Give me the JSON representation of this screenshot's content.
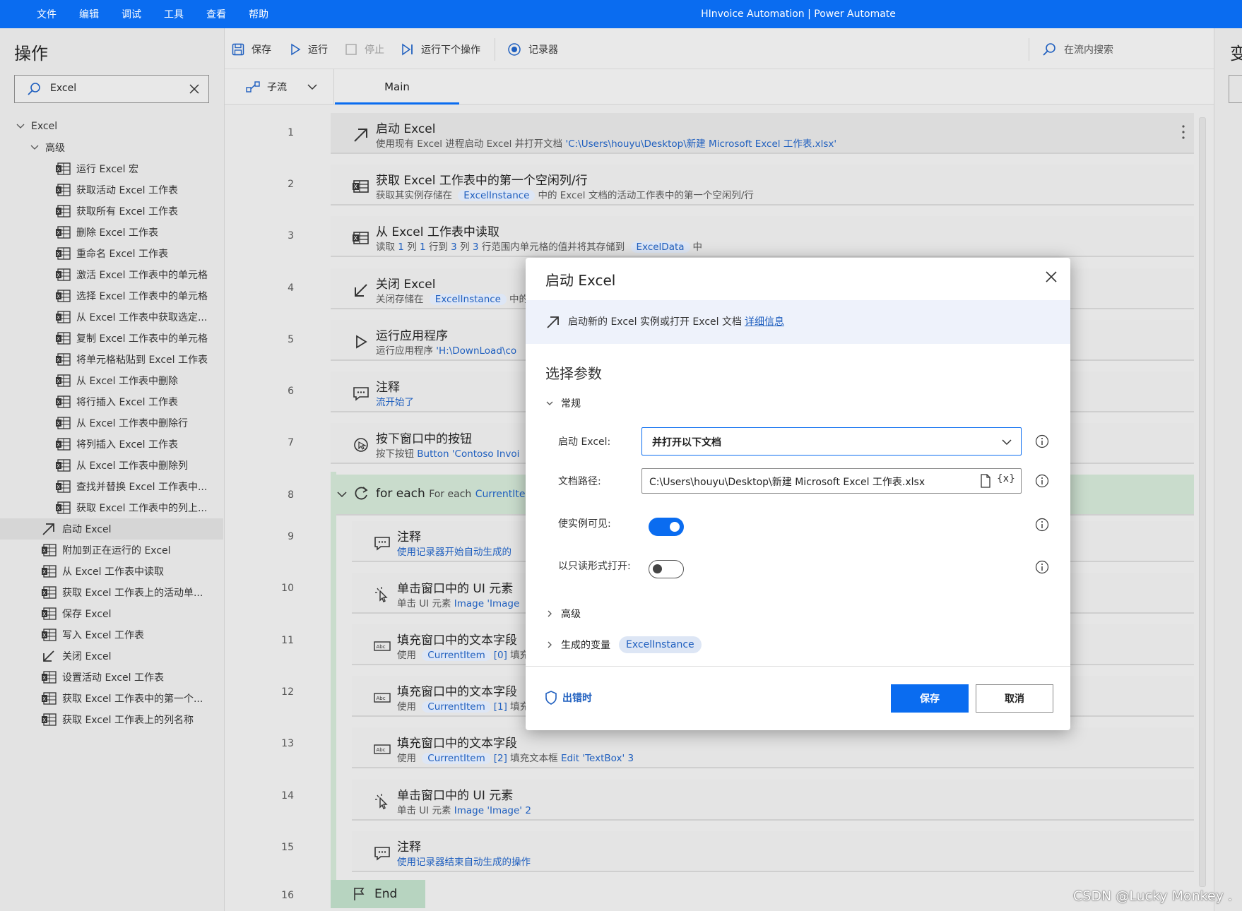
{
  "menu": [
    "文件",
    "编辑",
    "调试",
    "工具",
    "查看",
    "帮助"
  ],
  "window_title": "HInvoice Automation | Power Automate",
  "left_panel": {
    "title": "操作",
    "search_value": "Excel",
    "group": "Excel",
    "subgroup": "高级",
    "advanced_items": [
      "运行 Excel 宏",
      "获取活动 Excel 工作表",
      "获取所有 Excel 工作表",
      "删除 Excel 工作表",
      "重命名 Excel 工作表",
      "激活 Excel 工作表中的单元格",
      "选择 Excel 工作表中的单元格",
      "从 Excel 工作表中获取选定...",
      "复制 Excel 工作表中的单元格",
      "将单元格粘贴到 Excel 工作表",
      "从 Excel 工作表中删除",
      "将行插入 Excel 工作表",
      "从 Excel 工作表中删除行",
      "将列插入 Excel 工作表",
      "从 Excel 工作表中删除列",
      "查找并替换 Excel 工作表中...",
      "获取 Excel 工作表中的列上..."
    ],
    "items": [
      "启动 Excel",
      "附加到正在运行的 Excel",
      "从 Excel 工作表中读取",
      "获取 Excel 工作表上的活动单...",
      "保存 Excel",
      "写入 Excel 工作表",
      "关闭 Excel",
      "设置活动 Excel 工作表",
      "获取 Excel 工作表中的第一个...",
      "获取 Excel 工作表上的列名称"
    ]
  },
  "toolbar": {
    "save": "保存",
    "run": "运行",
    "stop": "停止",
    "run_next": "运行下个操作",
    "recorder": "记录器",
    "search": "在流内搜索"
  },
  "tabs": {
    "subflow": "子流",
    "main": "Main"
  },
  "right_pane": {
    "title": "变"
  },
  "flow": {
    "a1": {
      "no": "1",
      "title": "启动 Excel",
      "desc_pre": "使用现有 Excel 进程启动 Excel 并打开文档",
      "desc_path": "'C:\\Users\\houyu\\Desktop\\新建 Microsoft Excel 工作表.xlsx'"
    },
    "a2": {
      "no": "2",
      "title": "获取 Excel 工作表中的第一个空闲列/行",
      "desc_pre": "获取其实例存储在",
      "tag": "ExcelInstance",
      "desc_post": "中的 Excel 文档的活动工作表中的第一个空闲列/行"
    },
    "a3": {
      "no": "3",
      "title": "从 Excel 工作表中读取",
      "p1": "读取",
      "n1": "1",
      "p2": "列",
      "n2": "1",
      "p3": "行到",
      "n3": "3",
      "p4": "列",
      "n4": "3",
      "p5": "行范围内单元格的值并将其存储到",
      "tag": "ExcelData",
      "p6": "中"
    },
    "a4": {
      "no": "4",
      "title": "关闭 Excel",
      "desc_pre": "关闭存储在",
      "tag": "ExcelInstance",
      "desc_post": "中的"
    },
    "a5": {
      "no": "5",
      "title": "运行应用程序",
      "desc_pre": "运行应用程序",
      "desc_link": "'H:\\DownLoad\\co"
    },
    "a6": {
      "no": "6",
      "title": "注释",
      "desc_link": "流开始了"
    },
    "a7": {
      "no": "7",
      "title": "按下窗口中的按钮",
      "desc_pre": "按下按钮",
      "desc_link": "Button 'Contoso Invoi"
    },
    "a8": {
      "no": "8",
      "title": "for each",
      "sub": "For each",
      "tag": "CurrentIte"
    },
    "a9": {
      "no": "9",
      "title": "注释",
      "desc_link": "使用记录器开始自动生成的"
    },
    "a10": {
      "no": "10",
      "title": "单击窗口中的 UI 元素",
      "desc_pre": "单击 UI 元素",
      "desc_link": "Image 'Image"
    },
    "a11": {
      "no": "11",
      "title": "填充窗口中的文本字段",
      "desc_pre": "使用",
      "tag": "CurrentItem",
      "idx": "[0]",
      "desc_post": "填充"
    },
    "a12": {
      "no": "12",
      "title": "填充窗口中的文本字段",
      "desc_pre": "使用",
      "tag": "CurrentItem",
      "idx": "[1]",
      "desc_post": "填充"
    },
    "a13": {
      "no": "13",
      "title": "填充窗口中的文本字段",
      "desc_pre": "使用",
      "tag": "CurrentItem",
      "idx": "[2]",
      "desc_mid": "填充文本框",
      "desc_link": "Edit 'TextBox' 3"
    },
    "a14": {
      "no": "14",
      "title": "单击窗口中的 UI 元素",
      "desc_pre": "单击 UI 元素",
      "desc_link": "Image 'Image' 2"
    },
    "a15": {
      "no": "15",
      "title": "注释",
      "desc_link": "使用记录器结束自动生成的操作"
    },
    "a16": {
      "no": "16",
      "title": "End"
    }
  },
  "modal": {
    "title": "启动 Excel",
    "info_text": "启动新的 Excel 实例或打开 Excel 文档",
    "info_link": "详细信息",
    "section": "选择参数",
    "group_general": "常规",
    "launch_label": "启动 Excel:",
    "launch_value": "并打开以下文档",
    "path_label": "文档路径:",
    "path_value": "C:\\Users\\houyu\\Desktop\\新建 Microsoft Excel 工作表.xlsx",
    "var_btn": "{x}",
    "visible_label": "使实例可见:",
    "visible_on": true,
    "readonly_label": "以只读形式打开:",
    "readonly_on": false,
    "group_advanced": "高级",
    "group_vars": "生成的变量",
    "var_name": "ExcelInstance",
    "on_error": "出错时",
    "save": "保存",
    "cancel": "取消"
  },
  "watermark": "CSDN @Lucky Monkey ."
}
